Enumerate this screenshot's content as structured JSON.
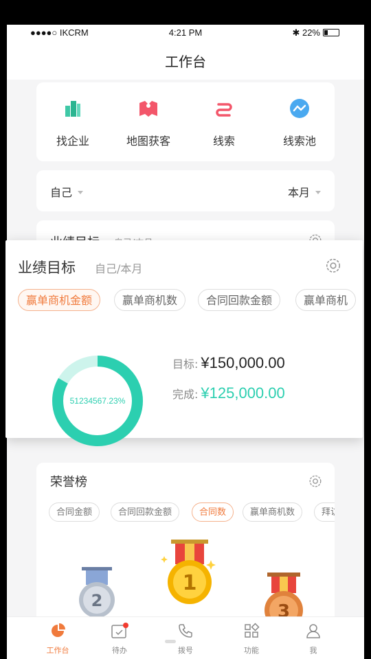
{
  "status_bar": {
    "carrier": "●●●●○ IKCRM",
    "time": "4:21 PM",
    "battery": "22%"
  },
  "header": {
    "title": "工作台"
  },
  "quick_actions": [
    {
      "label": "找企业",
      "icon": "building-icon"
    },
    {
      "label": "地图获客",
      "icon": "map-icon"
    },
    {
      "label": "线索",
      "icon": "lead-icon"
    },
    {
      "label": "线索池",
      "icon": "lead-pool-icon"
    }
  ],
  "filters": {
    "scope": "自己",
    "period": "本月"
  },
  "goal_card": {
    "title": "业绩目标",
    "subtitle": "自己/本月"
  },
  "goal_popup": {
    "title": "业绩目标",
    "subtitle": "自己/本月",
    "tabs": [
      "赢单商机金额",
      "赢单商机数",
      "合同回款金额",
      "赢单商机"
    ],
    "active_tab": 0,
    "ring_label": "51234567.23%",
    "target_label": "目标:",
    "target_value": "¥150,000.00",
    "done_label": "完成:",
    "done_value": "¥125,000.00",
    "progress_fraction": 0.8333,
    "colors": {
      "ring": "#2ccfb0",
      "ring_bg": "#cdf4ec",
      "accent": "#f07a3c"
    }
  },
  "honor": {
    "title": "荣誉榜",
    "tabs": [
      "合同金额",
      "合同回款金额",
      "合同数",
      "赢单商机数",
      "拜访"
    ],
    "active_tab": 2,
    "medals": [
      "2",
      "1",
      "3"
    ]
  },
  "tabbar": [
    {
      "label": "工作台",
      "icon": "pie-chart-icon",
      "active": true
    },
    {
      "label": "待办",
      "icon": "calendar-check-icon",
      "active": false,
      "badge": true
    },
    {
      "label": "拨号",
      "icon": "phone-icon",
      "active": false
    },
    {
      "label": "功能",
      "icon": "grid-icon",
      "active": false
    },
    {
      "label": "我",
      "icon": "person-icon",
      "active": false
    }
  ]
}
